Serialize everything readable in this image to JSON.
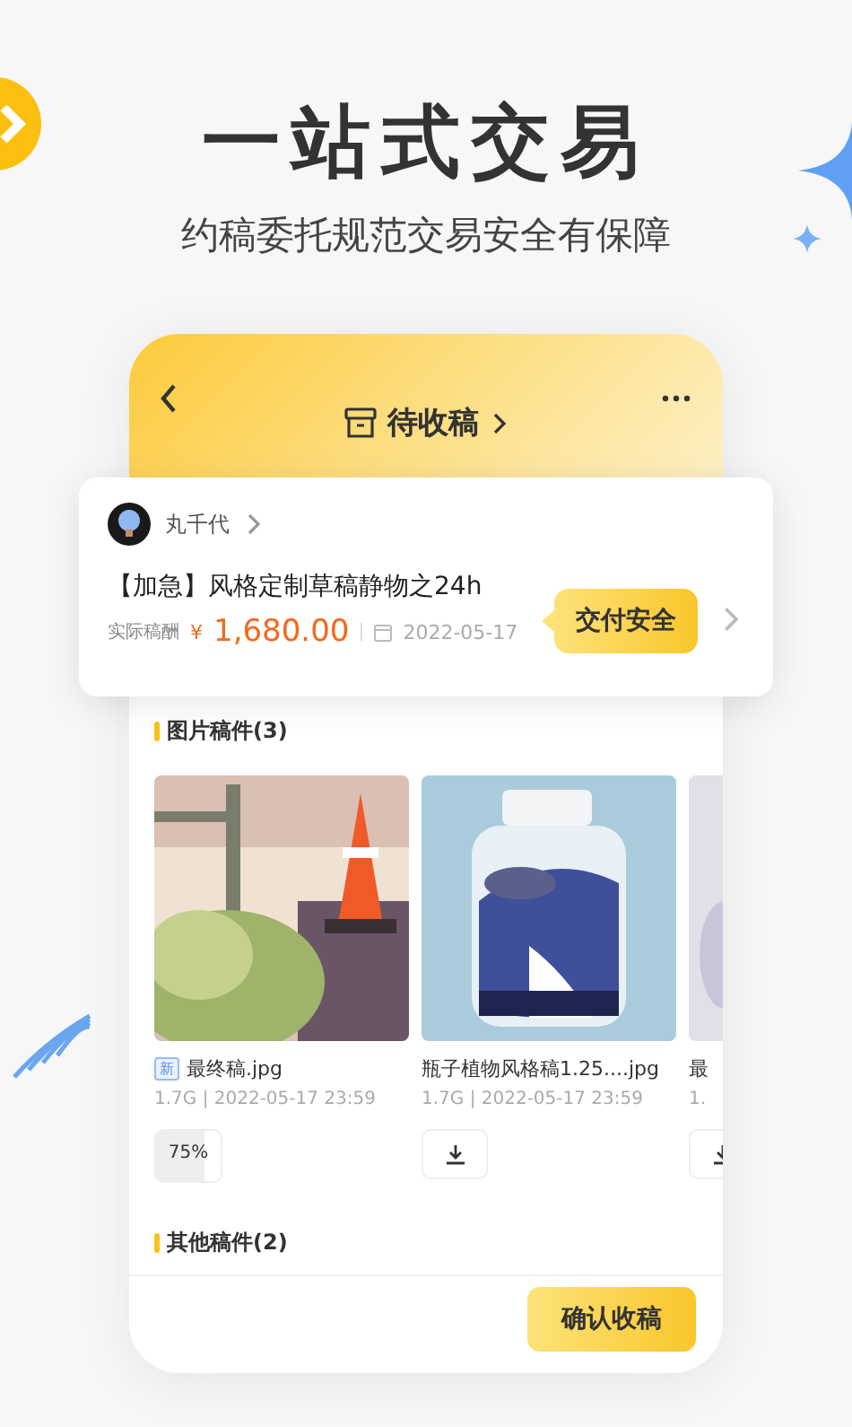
{
  "headline": "一站式交易",
  "subheadline": "约稿委托规范交易安全有保障",
  "phone": {
    "title": "待收稿",
    "order": {
      "author": "丸千代",
      "title": "【加急】风格定制草稿静物之24h",
      "fee_label": "实际稿酬",
      "currency": "¥",
      "amount": "1,680.00",
      "date": "2022-05-17",
      "badge": "交付安全"
    },
    "sections": [
      {
        "title": "图片稿件(3)",
        "files": [
          {
            "name": "最终稿.jpg",
            "is_new": true,
            "new_label": "新",
            "meta": "1.7G | 2022-05-17 23:59",
            "kind": "progress",
            "level": 0.75,
            "reading": "75%"
          },
          {
            "name": "瓶子植物风格稿1.25....jpg",
            "is_new": false,
            "meta": "1.7G | 2022-05-17 23:59",
            "kind": "download"
          },
          {
            "name": "最",
            "is_new": false,
            "meta": "1.",
            "kind": "download"
          }
        ]
      },
      {
        "title": "其他稿件(2)"
      }
    ],
    "confirm_button": "确认收稿"
  }
}
